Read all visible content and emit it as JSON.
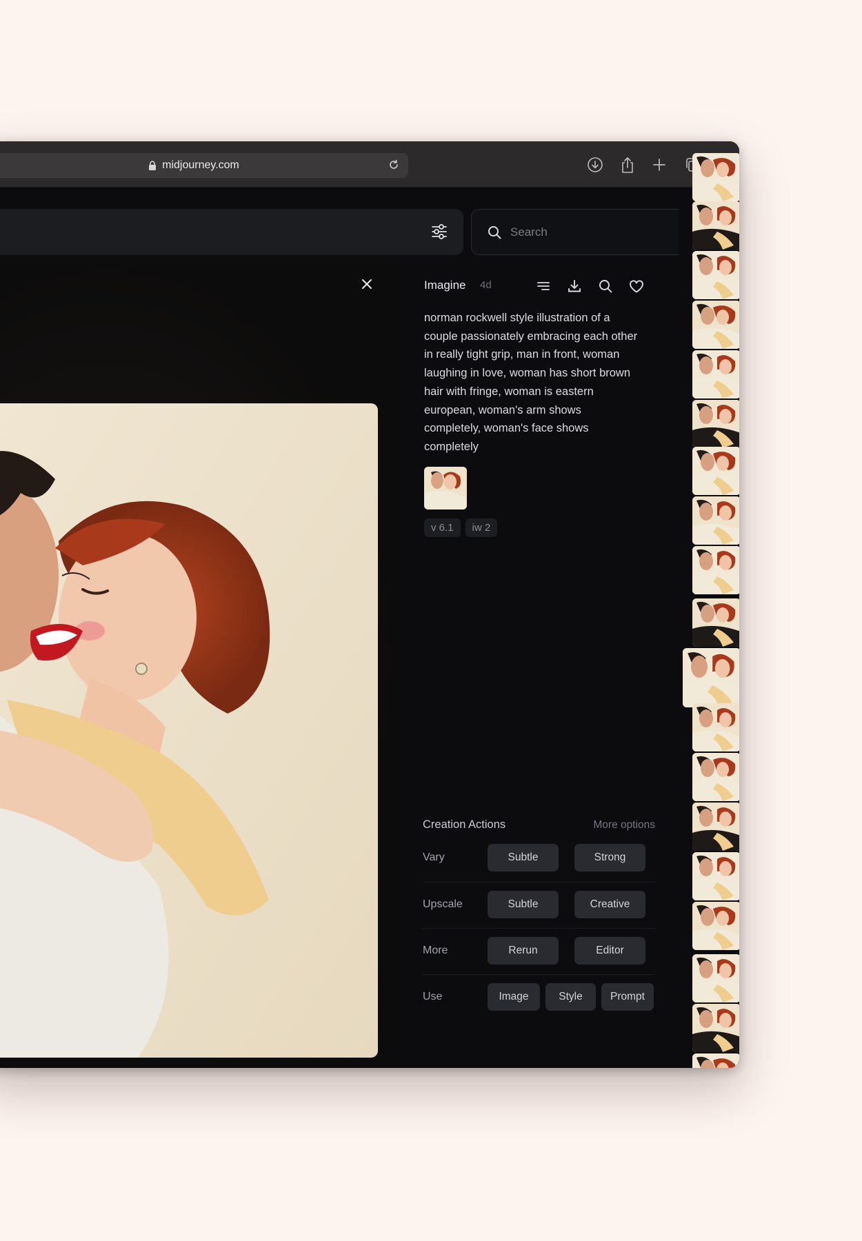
{
  "browser": {
    "url": "midjourney.com",
    "icons": [
      "lock-icon",
      "reload-icon",
      "download-icon",
      "share-icon",
      "new-tab-icon",
      "tabs-overview-icon"
    ]
  },
  "toolbar": {
    "search_placeholder": "Search",
    "icons": [
      "filter-sliders-icon",
      "search-icon"
    ]
  },
  "detail": {
    "title": "Imagine",
    "age": "4d",
    "prompt": "norman rockwell style illustration of a couple passionately embracing each other in really tight grip, man in front, woman laughing in love, woman has short brown hair with fringe, woman is eastern european, woman's arm shows completely, woman's face shows completely",
    "parameters": [
      "v 6.1",
      "iw 2"
    ],
    "header_icons": [
      "list-icon",
      "download-icon",
      "search-icon",
      "heart-icon"
    ]
  },
  "creation_actions": {
    "title": "Creation Actions",
    "more_options": "More options",
    "rows": [
      {
        "label": "Vary",
        "buttons": [
          "Subtle",
          "Strong"
        ]
      },
      {
        "label": "Upscale",
        "buttons": [
          "Subtle",
          "Creative"
        ]
      },
      {
        "label": "More",
        "buttons": [
          "Rerun",
          "Editor"
        ]
      },
      {
        "label": "Use",
        "buttons": [
          "Image",
          "Style",
          "Prompt"
        ]
      }
    ]
  },
  "colors": {
    "page_background": "#fdf3ef",
    "app_background": "#0c0c0e",
    "button_background": "#2a2b30",
    "browser_chrome": "#2c2a2a"
  }
}
